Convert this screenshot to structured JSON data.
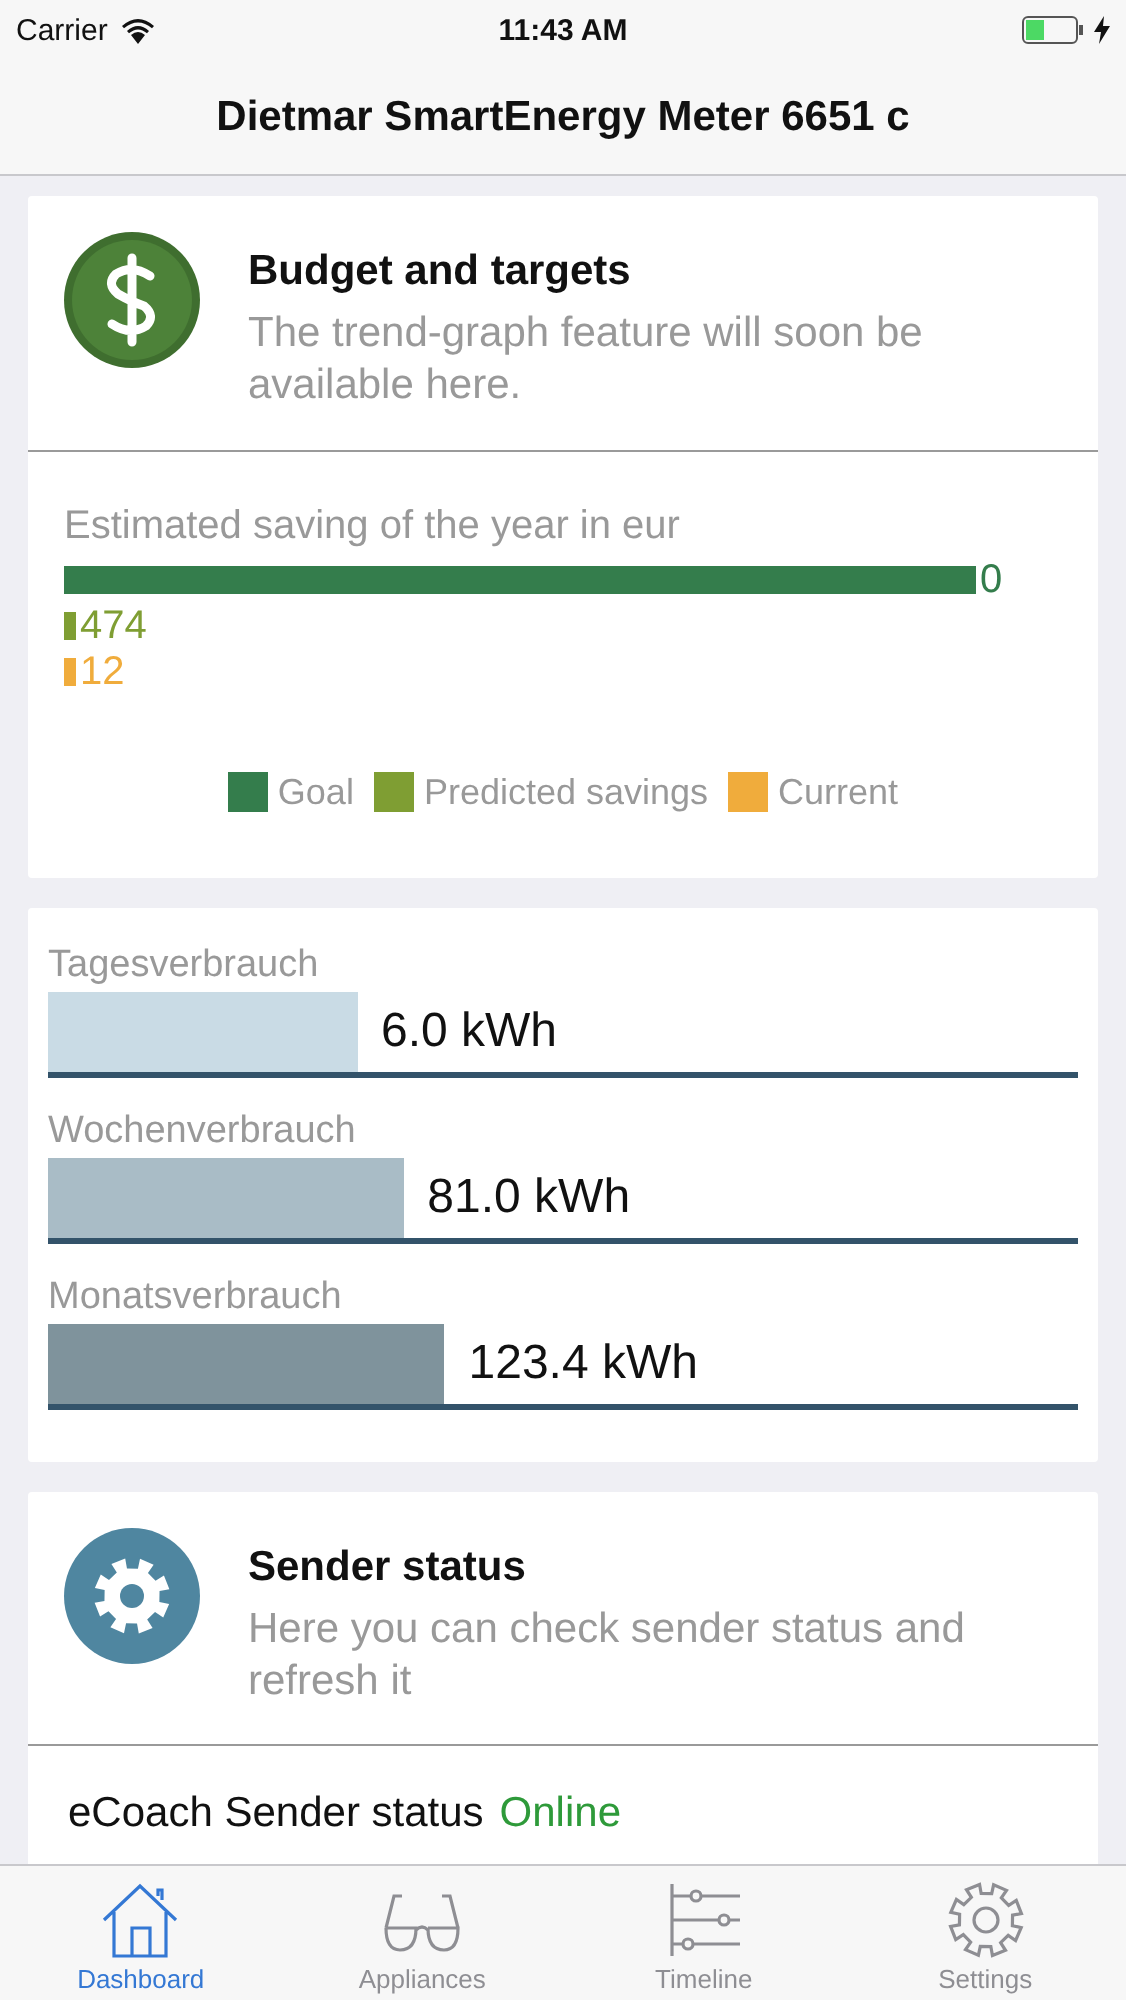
{
  "status_bar": {
    "carrier": "Carrier",
    "time": "11:43 AM"
  },
  "nav": {
    "title": "Dietmar SmartEnergy Meter 6651 c"
  },
  "budget": {
    "title": "Budget and targets",
    "subtitle": "The trend-graph feature will soon be available here.",
    "chart_title": "Estimated saving of the year in eur",
    "bars": [
      {
        "label": "0",
        "color": "#347d4c"
      },
      {
        "label": "474",
        "color": "#7f9e33"
      },
      {
        "label": "12",
        "color": "#f0ac3c"
      }
    ],
    "legend": [
      {
        "label": "Goal",
        "color": "#347d4c"
      },
      {
        "label": "Predicted savings",
        "color": "#7f9e33"
      },
      {
        "label": "Current",
        "color": "#f0ac3c"
      }
    ]
  },
  "usage": [
    {
      "title": "Tagesverbrauch",
      "reading": "6.0 kWh",
      "level": 0.3,
      "color": "#c9dbe5"
    },
    {
      "title": "Wochenverbrauch",
      "reading": "81.0 kWh",
      "level": 0.345,
      "color": "#a9bcc6"
    },
    {
      "title": "Monatsverbrauch",
      "reading": "123.4 kWh",
      "level": 0.385,
      "color": "#7f939c"
    }
  ],
  "sender": {
    "title": "Sender status",
    "subtitle": "Here you can check sender status and refresh it",
    "row_label": "eCoach Sender status",
    "row_value": "Online"
  },
  "tabs": [
    {
      "label": "Dashboard",
      "kind": "house",
      "selected": true
    },
    {
      "label": "Appliances",
      "kind": "glasses",
      "selected": false
    },
    {
      "label": "Timeline",
      "kind": "timeline",
      "selected": false
    },
    {
      "label": "Settings",
      "kind": "gear",
      "selected": false
    }
  ]
}
